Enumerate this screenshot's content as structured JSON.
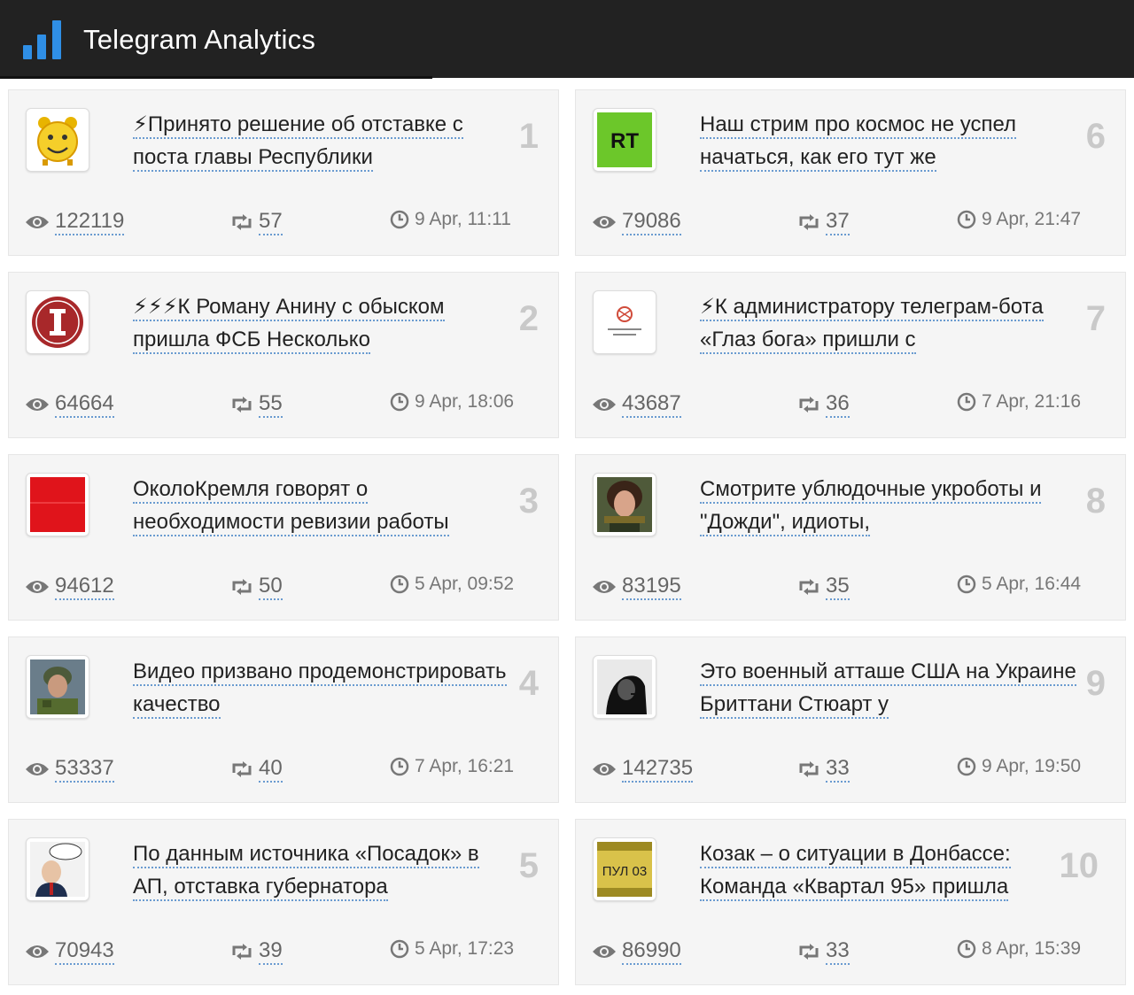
{
  "app": {
    "title": "Telegram Analytics",
    "accent": "#2f8fe6"
  },
  "icons": {
    "logo": "bar-chart-icon",
    "views": "eye-icon",
    "shares": "retweet-icon",
    "time": "clock-icon"
  },
  "posts": [
    {
      "rank": "1",
      "title": "⚡Принято решение об отставке с поста главы Республики",
      "views": "122119",
      "shares": "57",
      "date": "9 Apr, 11:11",
      "avatar": "alarm-clock-avatar"
    },
    {
      "rank": "6",
      "title": "Наш стрим про космос не успел начаться, как его тут же",
      "views": "79086",
      "shares": "37",
      "date": "9 Apr, 21:47",
      "avatar": "rt-logo-avatar"
    },
    {
      "rank": "2",
      "title": "⚡⚡⚡К Роману Анину с обыском пришла ФСБ Несколько",
      "views": "64664",
      "shares": "55",
      "date": "9 Apr, 18:06",
      "avatar": "red-i-logo-avatar"
    },
    {
      "rank": "7",
      "title": "⚡К администратору телеграм-бота «Глаз бога» пришли с",
      "views": "43687",
      "shares": "36",
      "date": "7 Apr, 21:16",
      "avatar": "net-freedoms-avatar",
      "avatar_text": "Net Freedoms Project"
    },
    {
      "rank": "3",
      "title": "ОколоКремля говорят о необходимости ревизии работы",
      "views": "94612",
      "shares": "50",
      "date": "5 Apr, 09:52",
      "avatar": "red-square-avatar"
    },
    {
      "rank": "8",
      "title": "Смотрите ублюдочные укроботы и \"Дожди\", идиоты,",
      "views": "83195",
      "shares": "35",
      "date": "5 Apr, 16:44",
      "avatar": "woman-photo-avatar"
    },
    {
      "rank": "4",
      "title": "Видео призвано продемонстрировать качество",
      "views": "53337",
      "shares": "40",
      "date": "7 Apr, 16:21",
      "avatar": "soldier-photo-avatar"
    },
    {
      "rank": "9",
      "title": "Это военный атташе США на Украине Бриттани Стюарт у",
      "views": "142735",
      "shares": "33",
      "date": "9 Apr, 19:50",
      "avatar": "smoking-portrait-avatar"
    },
    {
      "rank": "5",
      "title": "По данным источника «Посадок» в АП, отставка губернатора",
      "views": "70943",
      "shares": "39",
      "date": "5 Apr, 17:23",
      "avatar": "cartoon-portrait-avatar"
    },
    {
      "rank": "10",
      "title": "Козак – о ситуации в Донбассе: Команда «Квартал 95» пришла",
      "views": "86990",
      "shares": "33",
      "date": "8 Apr, 15:39",
      "avatar": "pul-03-avatar",
      "avatar_text": "ПУЛ 03"
    }
  ]
}
